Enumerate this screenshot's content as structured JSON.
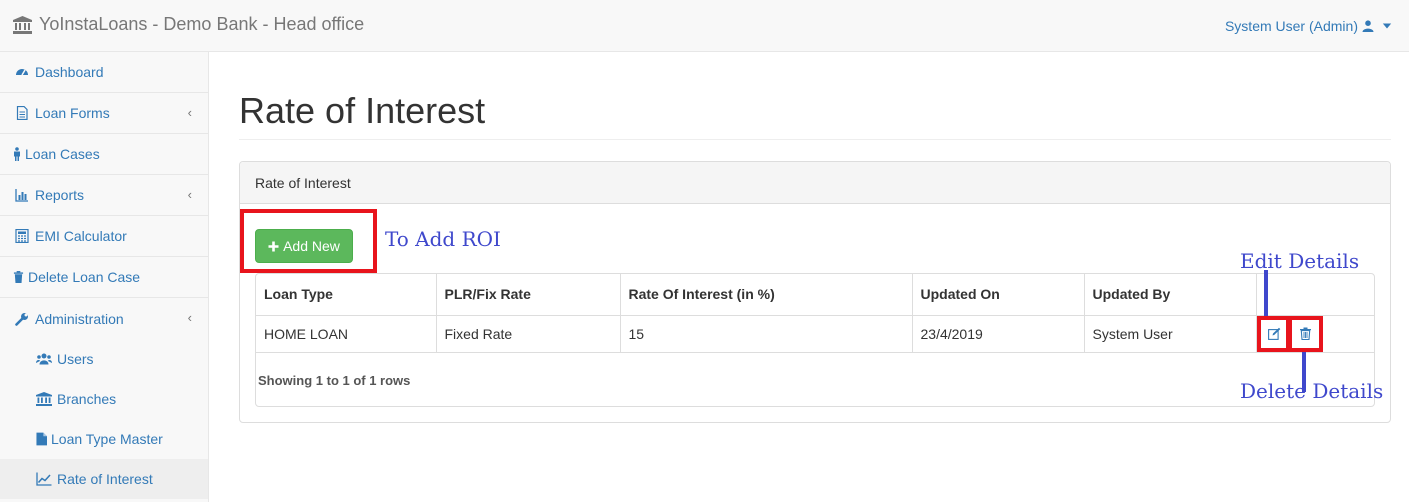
{
  "app": {
    "brand": "YoInstaLoans - Demo Bank - Head office",
    "user": "System User (Admin)"
  },
  "sidebar": {
    "items": [
      {
        "label": "Dashboard",
        "icon": "dashboard-icon"
      },
      {
        "label": "Loan Forms",
        "icon": "file-icon",
        "expandable": true
      },
      {
        "label": "Loan Cases",
        "icon": "person-icon"
      },
      {
        "label": "Reports",
        "icon": "bar-chart-icon",
        "expandable": true
      },
      {
        "label": "EMI Calculator",
        "icon": "calculator-icon"
      },
      {
        "label": "Delete Loan Case",
        "icon": "trash-icon"
      },
      {
        "label": "Administration",
        "icon": "wrench-icon",
        "expandable": true
      }
    ],
    "subitems": [
      {
        "label": "Users",
        "icon": "users-icon"
      },
      {
        "label": "Branches",
        "icon": "bank-icon"
      },
      {
        "label": "Loan Type Master",
        "icon": "file-icon"
      },
      {
        "label": "Rate of Interest",
        "icon": "line-chart-icon",
        "active": true
      }
    ],
    "chevron": "‹"
  },
  "main": {
    "title": "Rate of Interest",
    "panel_heading": "Rate of Interest",
    "add_button": "Add New",
    "table": {
      "headers": [
        "Loan Type",
        "PLR/Fix Rate",
        "Rate Of Interest (in %)",
        "Updated On",
        "Updated By",
        ""
      ],
      "rows": [
        [
          "HOME LOAN",
          "Fixed Rate",
          "15",
          "23/4/2019",
          "System User"
        ]
      ],
      "footer": "Showing 1 to 1 of 1 rows"
    }
  },
  "annotations": {
    "add": "To Add ROI",
    "edit": "Edit Details",
    "delete": "Delete Details"
  },
  "colors": {
    "link": "#337ab7",
    "success": "#5cb85c",
    "highlight": "#e8141c",
    "annotation": "#3f48cc"
  }
}
